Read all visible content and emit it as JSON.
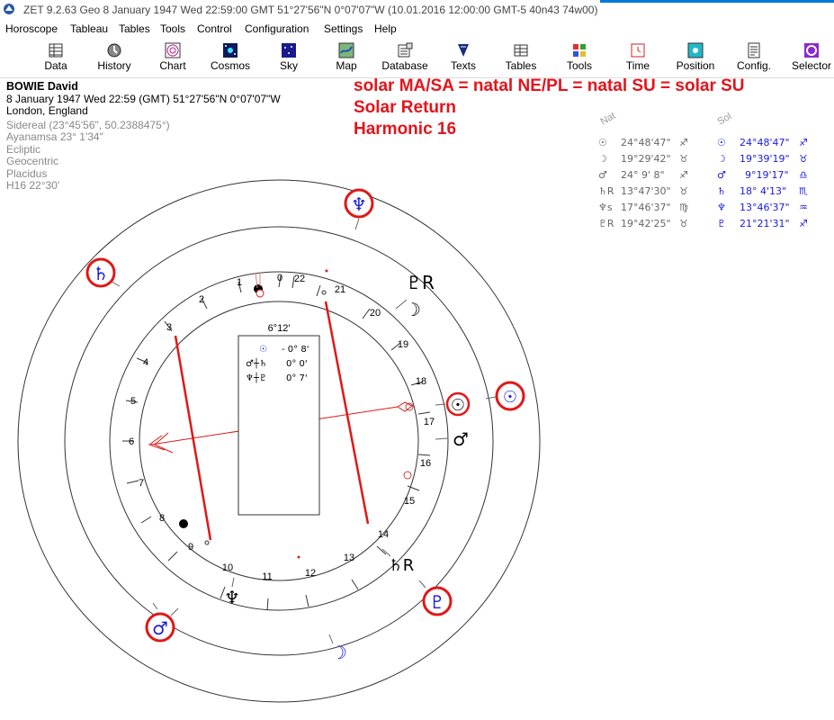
{
  "window": {
    "title": "ZET 9.2.63 Geo    8 January 1947   Wed   22:59:00 GMT 51°27'56\"N  0°07'07\"W  (10.01.2016  12:00:00 GMT-5 40n43 74w00)"
  },
  "menu": [
    "Horoscope",
    "Tableau",
    "Tables",
    "Tools",
    "Control",
    "Configuration",
    "Settings",
    "Help"
  ],
  "toolbar": [
    {
      "label": "Data",
      "icon": "data-icon"
    },
    {
      "label": "History",
      "icon": "history-icon"
    },
    {
      "label": "Chart",
      "icon": "chart-icon"
    },
    {
      "label": "Cosmos",
      "icon": "cosmos-icon"
    },
    {
      "label": "Sky",
      "icon": "sky-icon"
    },
    {
      "label": "Map",
      "icon": "map-icon"
    },
    {
      "label": "Database",
      "icon": "database-icon"
    },
    {
      "label": "Texts",
      "icon": "texts-icon"
    },
    {
      "label": "Tables",
      "icon": "tables-icon"
    },
    {
      "label": "Tools",
      "icon": "tools-icon"
    },
    {
      "label": "Time",
      "icon": "time-icon"
    },
    {
      "label": "Position",
      "icon": "position-icon"
    },
    {
      "label": "Config.",
      "icon": "config-icon"
    },
    {
      "label": "Selector",
      "icon": "selector-icon"
    }
  ],
  "info": {
    "name": "BOWIE David",
    "date_line": "8 January 1947  Wed  22:59 (GMT) 51°27'56\"N  0°07'07\"W",
    "place": "London, England",
    "details": [
      "Sidereal (23°45'56\", 50.2388475°)",
      "Ayanamsa 23° 1'34\"",
      "Ecliptic",
      "Geocentric",
      "Placidus",
      "H16  22°30'"
    ]
  },
  "headline": [
    "solar MA/SA = natal NE/PL = natal SU = solar SU",
    "Solar Return",
    "Harmonic 16"
  ],
  "positions": {
    "nat_header": "Nat",
    "sol_header": "Sol",
    "nat": [
      {
        "glyph": "☉",
        "value": "24°48'47\"",
        "sign": "♐"
      },
      {
        "glyph": "☽",
        "value": "19°29'42\"",
        "sign": "♉"
      },
      {
        "glyph": "♂",
        "value": "24° 9' 8\"",
        "sign": "♐"
      },
      {
        "glyph": "♄R",
        "value": "13°47'30\"",
        "sign": "♉"
      },
      {
        "glyph": "♆s",
        "value": "17°46'37\"",
        "sign": "♍"
      },
      {
        "glyph": "♇R",
        "value": "19°42'25\"",
        "sign": "♉"
      }
    ],
    "sol": [
      {
        "glyph": "☉",
        "value": "24°48'47\"",
        "sign": "♐"
      },
      {
        "glyph": "☽",
        "value": "19°39'19\"",
        "sign": "♉"
      },
      {
        "glyph": "♂",
        "value": "9°19'17\"",
        "sign": "♎"
      },
      {
        "glyph": "♄",
        "value": "18° 4'13\"",
        "sign": "♏"
      },
      {
        "glyph": "♆",
        "value": "13°46'37\"",
        "sign": "♒"
      },
      {
        "glyph": "♇",
        "value": "21°21'31\"",
        "sign": "♐"
      }
    ]
  },
  "wheel_labels": {
    "house_numbers": [
      "0",
      "1",
      "2",
      "3",
      "4",
      "5",
      "6",
      "7",
      "8",
      "9",
      "10",
      "11",
      "12",
      "13",
      "14",
      "15",
      "16",
      "17",
      "18",
      "19",
      "20",
      "21",
      "22"
    ],
    "top_angle": "6°12'",
    "aspects": [
      {
        "glyphs": "☉",
        "value": "- 0° 8'"
      },
      {
        "glyphs": "♂┼♄",
        "value": "0° 0'"
      },
      {
        "glyphs": "♆┼♇",
        "value": "0° 7'"
      }
    ],
    "inner_glyphs": [
      "♇R",
      "☽",
      "☉",
      "♂",
      "♄R",
      "♆"
    ],
    "outer_glyphs": [
      "♆",
      "♄",
      "☉",
      "♇",
      "♂",
      "☽"
    ],
    "retro_mark": "R"
  },
  "colors": {
    "accent_red": "#e3141b",
    "solar_blue": "#1a1adc",
    "chart_red": "#e01818",
    "titlebar_blue": "#0078d7"
  }
}
